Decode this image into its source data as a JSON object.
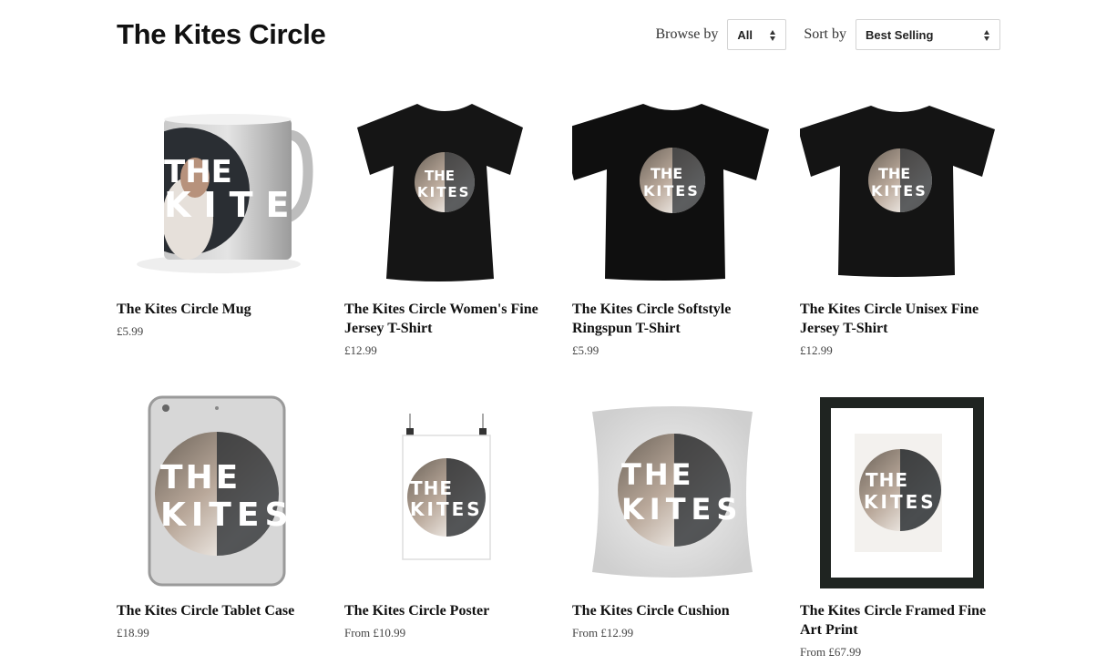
{
  "store": {
    "title": "The Kites Circle"
  },
  "filters": {
    "browse_label": "Browse by",
    "browse_value": "All",
    "sort_label": "Sort by",
    "sort_value": "Best Selling"
  },
  "artwork": {
    "line1": "THE",
    "line2": "KITES"
  },
  "products": [
    {
      "name": "The Kites Circle Mug",
      "price": "£5.99",
      "image": "mug"
    },
    {
      "name": "The Kites Circle Women's Fine Jersey T-Shirt",
      "price": "£12.99",
      "image": "womens-tshirt"
    },
    {
      "name": "The Kites Circle Softstyle Ringspun T-Shirt",
      "price": "£5.99",
      "image": "softstyle-tshirt"
    },
    {
      "name": "The Kites Circle Unisex Fine Jersey T-Shirt",
      "price": "£12.99",
      "image": "unisex-tshirt"
    },
    {
      "name": "The Kites Circle Tablet Case",
      "price": "£18.99",
      "image": "tablet-case"
    },
    {
      "name": "The Kites Circle Poster",
      "price": "From £10.99",
      "image": "poster"
    },
    {
      "name": "The Kites Circle Cushion",
      "price": "From £12.99",
      "image": "cushion"
    },
    {
      "name": "The Kites Circle Framed Fine Art Print",
      "price": "From £67.99",
      "image": "framed-print"
    }
  ]
}
